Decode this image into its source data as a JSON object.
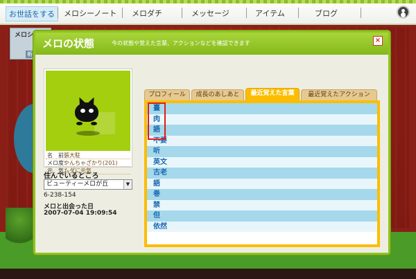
{
  "topnav": {
    "items": [
      "お世話をする",
      "メロシーノート",
      "メロダチ",
      "メッセージ",
      "アイテム",
      "ブログ"
    ]
  },
  "background": {
    "panel_text": "メロシ",
    "panel_button": "新着"
  },
  "dialog": {
    "title": "メロの状態",
    "subtitle": "今の状態や覚えた言葉、アクションなどを確認できます",
    "close_label": "×",
    "pet": {
      "name_label": "名　前：",
      "name_value": "張大駐",
      "age_label": "メロ度：",
      "age_value": "やんちゃざかり(201)",
      "mood_label": "元　気：",
      "mood_value": "ムダに元気"
    },
    "address_label": "住んでいるところ",
    "address_value": "ビューティーメロが丘",
    "address_code": "6-238-154",
    "meet_label": "メロと出会った日",
    "meet_date": "2007-07-04 19:09:54",
    "tabs": [
      "プロフィール",
      "成長のあしあと",
      "最近覚えた言葉",
      "最近覚えたアクション"
    ],
    "active_tab": "最近覚えた言葉",
    "words": [
      "臺",
      "肉",
      "語",
      "不要",
      "听",
      "英文",
      "古老",
      "語",
      "巻",
      "禁",
      "但",
      "依然"
    ]
  }
}
